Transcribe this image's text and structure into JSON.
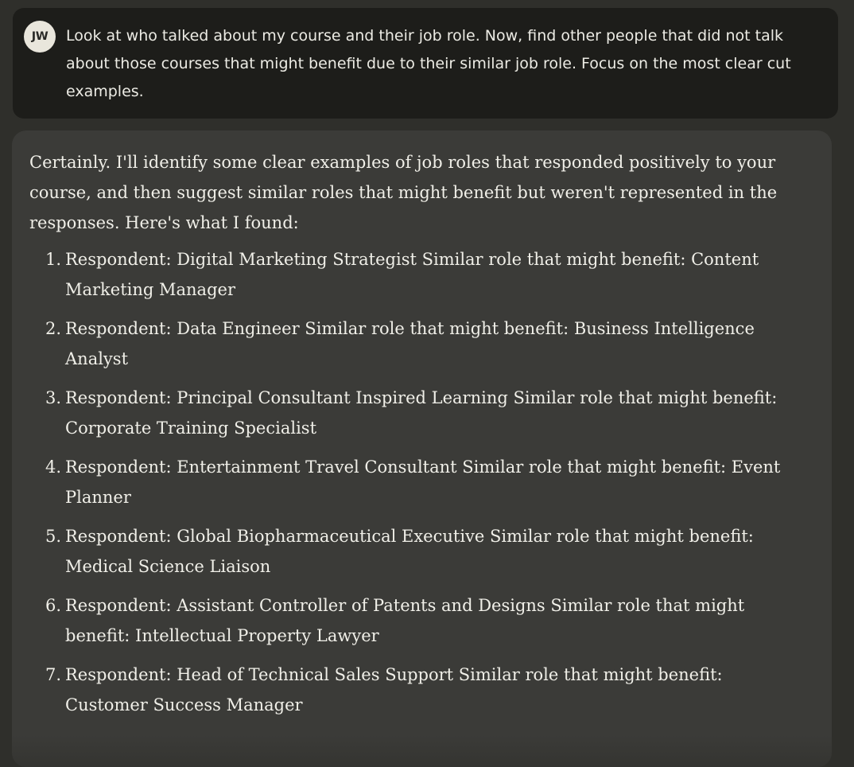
{
  "user_message": {
    "avatar_initials": "JW",
    "text": "Look at who talked about my course and their job role. Now, find other people that did not talk about those courses that might benefit due to their similar job role. Focus on the most clear cut examples."
  },
  "assistant_message": {
    "intro": "Certainly. I'll identify some clear examples of job roles that responded positively to your course, and then suggest similar roles that might benefit but weren't represented in the responses. Here's what I found:",
    "items": [
      {
        "number": "1.",
        "text": "Respondent: Digital Marketing Strategist Similar role that might benefit: Content Marketing Manager"
      },
      {
        "number": "2.",
        "text": "Respondent: Data Engineer Similar role that might benefit: Business Intelligence Analyst"
      },
      {
        "number": "3.",
        "text": "Respondent: Principal Consultant Inspired Learning Similar role that might benefit: Corporate Training Specialist"
      },
      {
        "number": "4.",
        "text": "Respondent: Entertainment Travel Consultant Similar role that might benefit: Event Planner"
      },
      {
        "number": "5.",
        "text": "Respondent: Global Biopharmaceutical Executive Similar role that might benefit: Medical Science Liaison"
      },
      {
        "number": "6.",
        "text": "Respondent: Assistant Controller of Patents and Designs Similar role that might benefit: Intellectual Property Lawyer"
      },
      {
        "number": "7.",
        "text": "Respondent: Head of Technical Sales Support Similar role that might benefit: Customer Success Manager"
      }
    ]
  },
  "colors": {
    "page_background": "#2f2f2b",
    "user_bubble": "#1d1d1a",
    "assistant_bubble": "#3b3b38",
    "avatar_background": "#e9e6dc",
    "text": "#f0efe8"
  }
}
